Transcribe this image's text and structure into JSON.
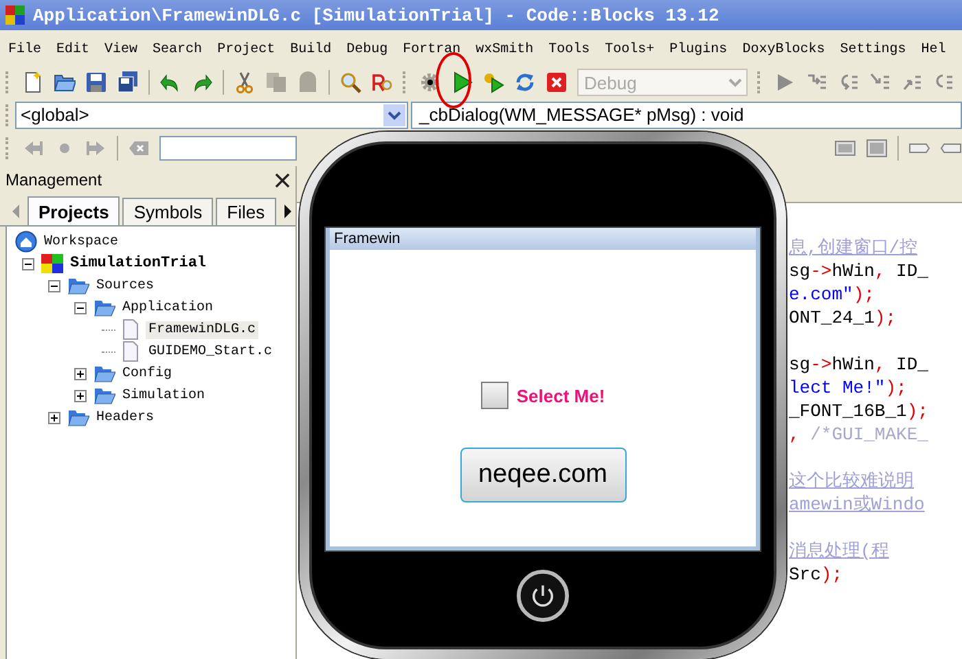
{
  "window": {
    "title": "Application\\FramewinDLG.c [SimulationTrial] - Code::Blocks 13.12"
  },
  "menu": [
    "File",
    "Edit",
    "View",
    "Search",
    "Project",
    "Build",
    "Debug",
    "Fortran",
    "wxSmith",
    "Tools",
    "Tools+",
    "Plugins",
    "DoxyBlocks",
    "Settings",
    "Hel"
  ],
  "toolbar": {
    "build_target": {
      "value": "Debug",
      "disabled": true
    }
  },
  "scope_bar": {
    "scope": "<global>",
    "function": "_cbDialog(WM_MESSAGE* pMsg) : void"
  },
  "management": {
    "title": "Management",
    "tabs": [
      {
        "label": "Projects",
        "selected": true
      },
      {
        "label": "Symbols",
        "selected": false
      },
      {
        "label": "Files",
        "selected": false
      }
    ],
    "tree": [
      {
        "label": "Workspace",
        "kind": "workspace",
        "selected": false,
        "children": [
          {
            "label": "SimulationTrial",
            "kind": "project",
            "expanded": true,
            "selected": false,
            "children": [
              {
                "label": "Sources",
                "kind": "folder",
                "expanded": true,
                "selected": false,
                "children": [
                  {
                    "label": "Application",
                    "kind": "folder",
                    "expanded": true,
                    "selected": false,
                    "children": [
                      {
                        "label": "FramewinDLG.c",
                        "kind": "file",
                        "selected": true
                      },
                      {
                        "label": "GUIDEMO_Start.c",
                        "kind": "file",
                        "selected": false
                      }
                    ]
                  },
                  {
                    "label": "Config",
                    "kind": "folder",
                    "expanded": false,
                    "selected": false
                  },
                  {
                    "label": "Simulation",
                    "kind": "folder",
                    "expanded": false,
                    "selected": false
                  }
                ]
              },
              {
                "label": "Headers",
                "kind": "folder",
                "expanded": false,
                "selected": false
              }
            ]
          }
        ]
      }
    ]
  },
  "editor": {
    "lines": [
      {
        "kind": "code",
        "segments": [
          {
            "text": "息,创建窗口/控",
            "kind": "doc_comment"
          }
        ]
      },
      {
        "kind": "code",
        "segments": [
          {
            "text": "sg",
            "kind": "code"
          },
          {
            "text": "->",
            "kind": "op"
          },
          {
            "text": "hWin",
            "kind": "code"
          },
          {
            "text": ",",
            "kind": "op"
          },
          {
            "text": " ID_",
            "kind": "code"
          }
        ]
      },
      {
        "kind": "code",
        "segments": [
          {
            "text": "e.com\"",
            "kind": "string"
          },
          {
            "text": ");",
            "kind": "op"
          }
        ]
      },
      {
        "kind": "code",
        "segments": [
          {
            "text": "ONT_24_1",
            "kind": "code"
          },
          {
            "text": ");",
            "kind": "op"
          }
        ]
      },
      {
        "kind": "blank"
      },
      {
        "kind": "code",
        "segments": [
          {
            "text": "sg",
            "kind": "code"
          },
          {
            "text": "->",
            "kind": "op"
          },
          {
            "text": "hWin",
            "kind": "code"
          },
          {
            "text": ",",
            "kind": "op"
          },
          {
            "text": " ID_",
            "kind": "code"
          }
        ]
      },
      {
        "kind": "code",
        "segments": [
          {
            "text": "lect Me!\"",
            "kind": "string"
          },
          {
            "text": ");",
            "kind": "op"
          }
        ]
      },
      {
        "kind": "code",
        "segments": [
          {
            "text": "_FONT_16B_1",
            "kind": "code"
          },
          {
            "text": ");",
            "kind": "op"
          }
        ]
      },
      {
        "kind": "code",
        "segments": [
          {
            "text": ",",
            "kind": "op"
          },
          {
            "text": " /*GUI_MAKE_",
            "kind": "comment"
          }
        ]
      },
      {
        "kind": "blank"
      },
      {
        "kind": "code",
        "segments": [
          {
            "text": "这个比较难说明",
            "kind": "doc_comment"
          }
        ]
      },
      {
        "kind": "code",
        "segments": [
          {
            "text": "amewin或Windo",
            "kind": "doc_comment"
          }
        ]
      },
      {
        "kind": "blank"
      },
      {
        "kind": "code",
        "segments": [
          {
            "text": "消息处理(程",
            "kind": "doc_comment"
          }
        ]
      },
      {
        "kind": "code",
        "segments": [
          {
            "text": "Src",
            "kind": "code"
          },
          {
            "text": ");",
            "kind": "op"
          }
        ]
      }
    ]
  },
  "simulator": {
    "frame_title": "Framewin",
    "checkbox": {
      "label": "Select Me!",
      "checked": false
    },
    "button": "neqee.com"
  }
}
